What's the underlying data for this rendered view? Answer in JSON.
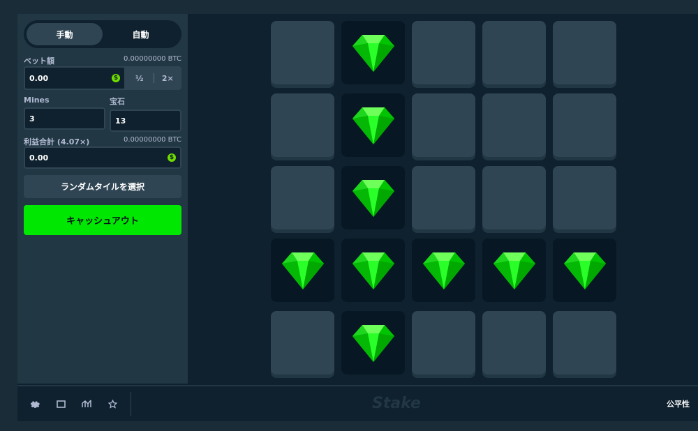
{
  "sidebar": {
    "modes": [
      "手動",
      "自動"
    ],
    "active_mode": "手動",
    "bet": {
      "label": "ベット額",
      "balance": "0.00000000 BTC",
      "value": "0.00",
      "currency_icon": "dollar-coin-icon",
      "half_label": "½",
      "double_label": "2×"
    },
    "mines": {
      "label": "Mines",
      "value": "3"
    },
    "gems": {
      "label": "宝石",
      "value": "13"
    },
    "profit": {
      "label": "利益合計 (4.07×)",
      "amount": "0.00000000 BTC",
      "value": "0.00"
    },
    "random_button": "ランダムタイルを選択",
    "cashout_button": "キャッシュアウト"
  },
  "grid": {
    "rows": [
      [
        "hidden",
        "gem",
        "hidden",
        "hidden",
        "hidden"
      ],
      [
        "hidden",
        "gem",
        "hidden",
        "hidden",
        "hidden"
      ],
      [
        "hidden",
        "gem",
        "hidden",
        "hidden",
        "hidden"
      ],
      [
        "gem",
        "gem",
        "gem",
        "gem",
        "gem"
      ],
      [
        "hidden",
        "gem",
        "hidden",
        "hidden",
        "hidden"
      ]
    ],
    "gem_icon": "gem-icon",
    "gem_color": "#00e701"
  },
  "footer": {
    "icons": [
      "gear-icon",
      "window-icon",
      "stats-icon",
      "star-icon"
    ],
    "brand": "Stake",
    "fairness_label": "公平性"
  },
  "colors": {
    "accent": "#00e701",
    "panel": "#213743",
    "tile": "#2f4553",
    "background": "#0f212e"
  }
}
